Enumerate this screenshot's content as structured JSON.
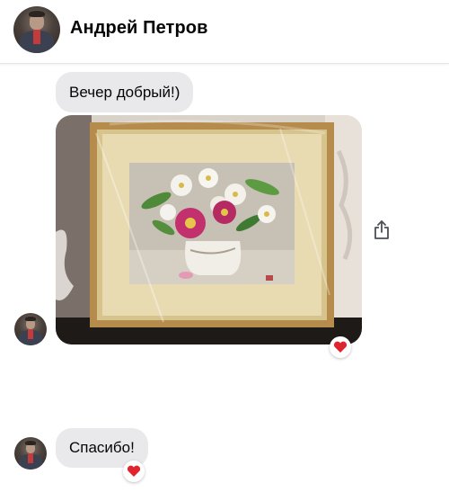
{
  "header": {
    "contact_name": "Андрей Петров",
    "avatar_icon": "user-avatar"
  },
  "messages": [
    {
      "type": "text",
      "text": "Вечер добрый!)"
    },
    {
      "type": "image",
      "description_icon": "framed-flower-painting-photo",
      "reaction": "heart"
    },
    {
      "type": "text",
      "text": "Спасибо!",
      "reaction": "heart"
    }
  ],
  "icons": {
    "share": "share-icon",
    "reaction": "heart-icon"
  },
  "colors": {
    "bubble": "#e9e9eb",
    "reaction_heart": "#e0242e",
    "divider": "#e4e6eb"
  }
}
